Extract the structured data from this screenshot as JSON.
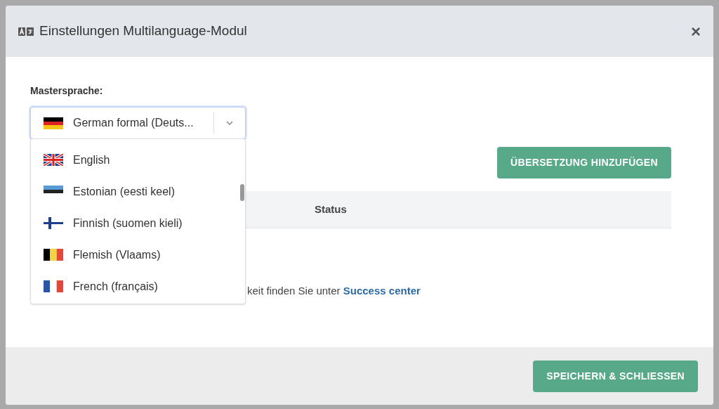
{
  "dialog": {
    "title": "Einstellungen Multilanguage-Modul",
    "close": "×"
  },
  "master_language": {
    "label": "Mastersprache:",
    "current": {
      "label": "German formal (Deuts...",
      "kind": "de"
    },
    "expanded": true,
    "options": [
      {
        "label": "English",
        "kind": "gb"
      },
      {
        "label": "Estonian (eesti keel)",
        "kind": "ee"
      },
      {
        "label": "Finnish (suomen kieli)",
        "kind": "fi"
      },
      {
        "label": "Flemish (Vlaams)",
        "kind": "be"
      },
      {
        "label": "French (français)",
        "kind": "fr"
      }
    ]
  },
  "add_button": "ÜBERSETZUNG HINZUFÜGEN",
  "table": {
    "columns": [
      "Status"
    ]
  },
  "help_text": {
    "text": "keit finden Sie unter ",
    "link": "Success center"
  },
  "footer": {
    "save_button": "SPEICHERN & SCHLIESSEN"
  }
}
